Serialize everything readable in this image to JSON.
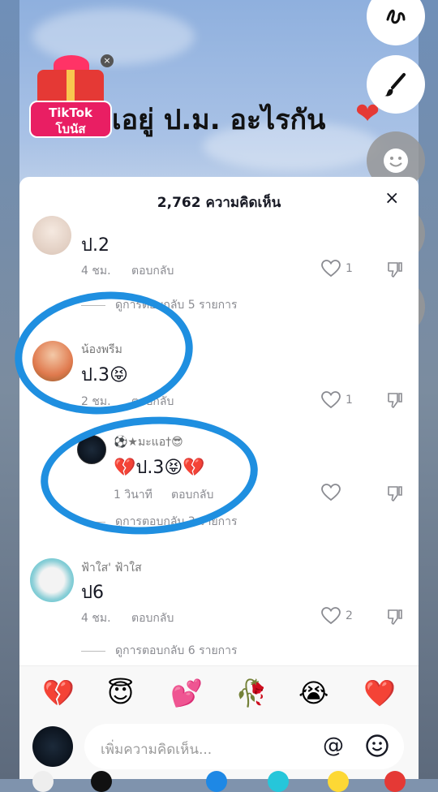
{
  "video": {
    "caption": "เอยู่ ป.ม. อะไรกัน",
    "gift_label_line1": "TikTok",
    "gift_label_line2": "โบนัส",
    "gift_close": "×"
  },
  "comments_panel": {
    "title": "2,762 ความคิดเห็น",
    "close": "×"
  },
  "comments": [
    {
      "text": "ป.2",
      "time": "4 ชม.",
      "reply_label": "ตอบกลับ",
      "likes": "1",
      "view_replies": "ดูการตอบกลับ 5 รายการ"
    },
    {
      "username": "น้องพรีม",
      "text": "ป.3😝",
      "time": "2 ชม.",
      "reply_label": "ตอบกลับ",
      "likes": "1"
    },
    {
      "username": "⚽★มะแอ†😎",
      "text": "💔ป.3😝💔",
      "time": "1 วินาที",
      "reply_label": "ตอบกลับ",
      "likes": "",
      "view_replies": "ดูการตอบกลับ 3 รายการ"
    },
    {
      "username": "ฟ้าใส' ฟ้าใส",
      "text": "ป6",
      "time": "4 ชม.",
      "reply_label": "ตอบกลับ",
      "likes": "2",
      "view_replies": "ดูการตอบกลับ 6 รายการ"
    }
  ],
  "quick_emojis": [
    "💔",
    "😇",
    "💕",
    "🥀",
    "😭",
    "❤️"
  ],
  "input": {
    "placeholder": "เพิ่มความคิดเห็น...",
    "at": "@"
  },
  "tools": [
    "squiggle-icon",
    "brush-icon",
    "smiley-icon",
    "eraser-icon",
    "swap-icon"
  ],
  "colors": {
    "annotation": "#1f8fe0",
    "heart": "#e53935"
  }
}
